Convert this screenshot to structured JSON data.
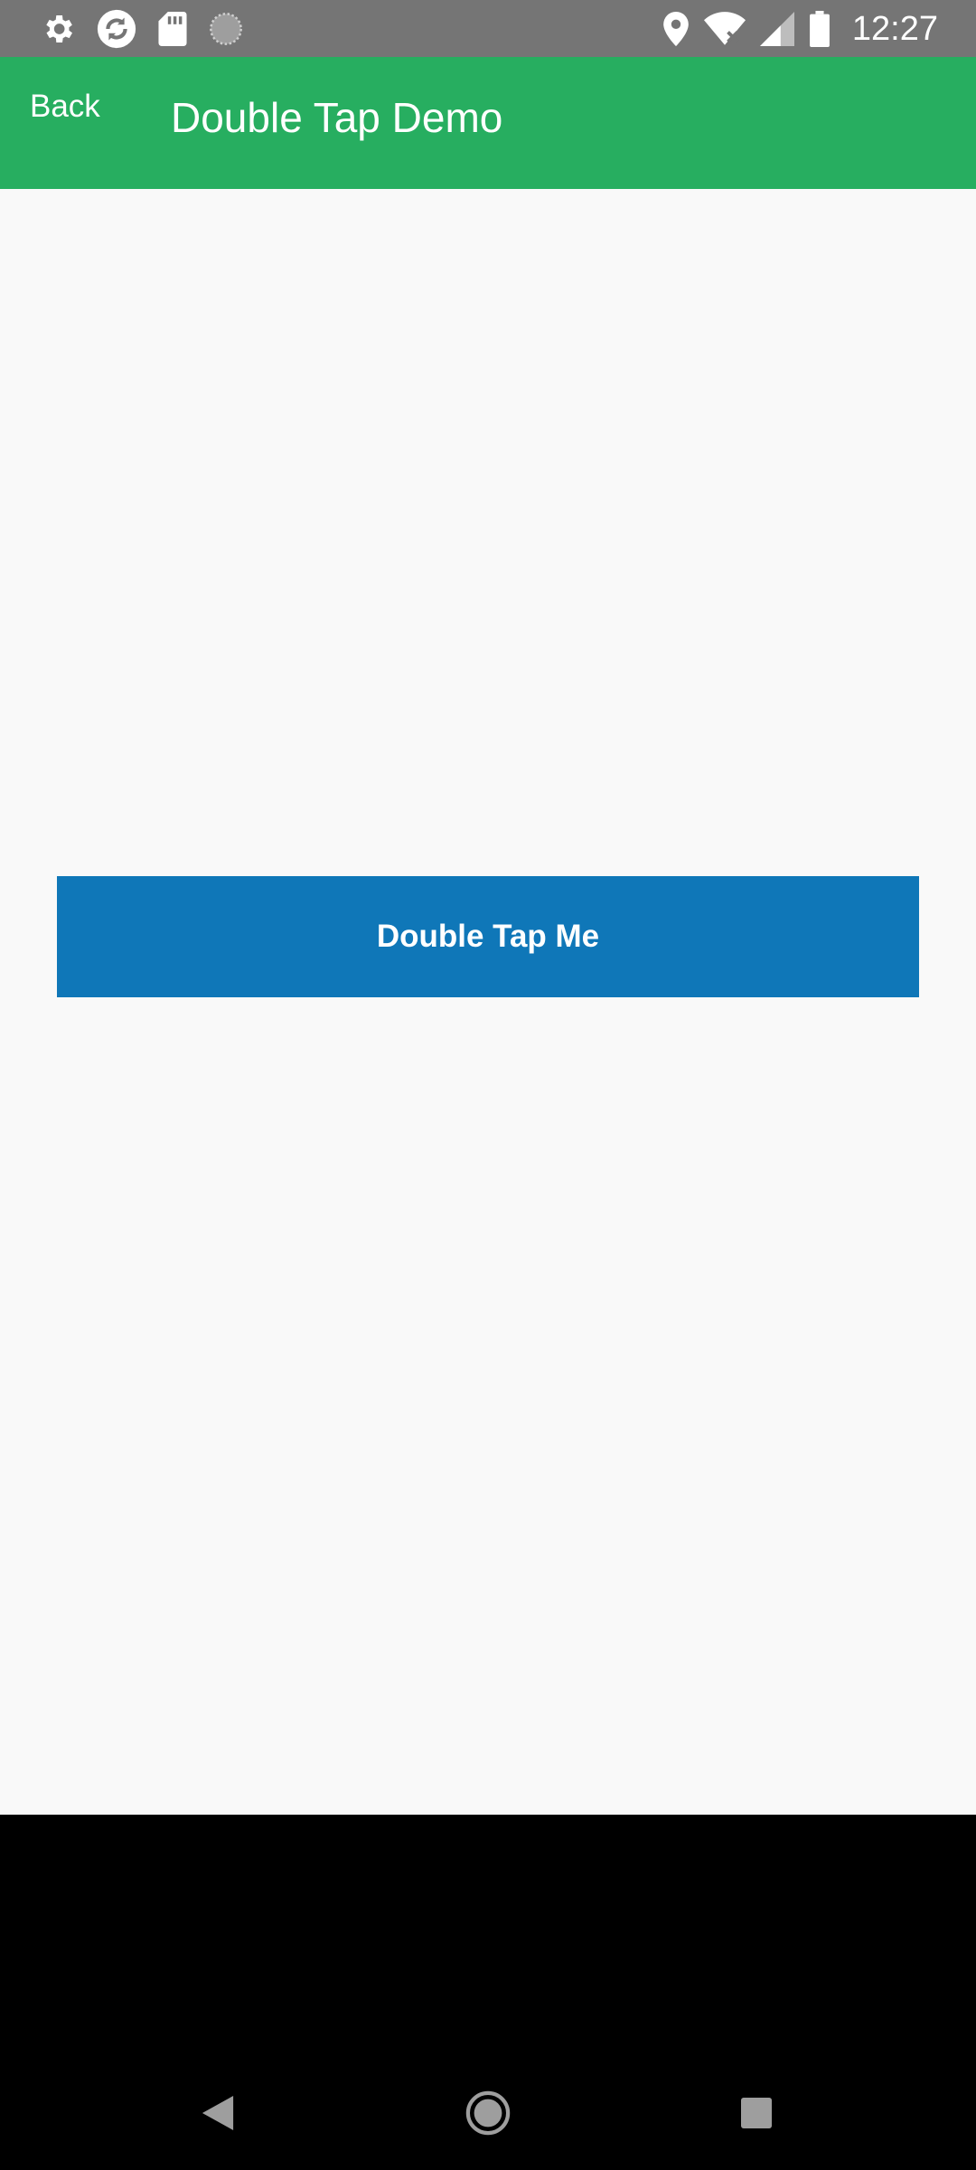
{
  "status_bar": {
    "time": "12:27",
    "left_icons": [
      "settings-icon",
      "sync-icon",
      "sd-card-icon",
      "loading-icon"
    ],
    "right_icons": [
      "location-icon",
      "wifi-off-icon",
      "cell-signal-icon",
      "battery-icon"
    ]
  },
  "app_bar": {
    "back_label": "Back",
    "title": "Double Tap Demo",
    "color": "#27ae60"
  },
  "main": {
    "button_label": "Double Tap Me",
    "button_color": "#0f77b8",
    "background": "#f9f9f9"
  },
  "nav_bar": {
    "buttons": [
      "back-triangle-icon",
      "home-circle-icon",
      "recents-square-icon"
    ]
  }
}
